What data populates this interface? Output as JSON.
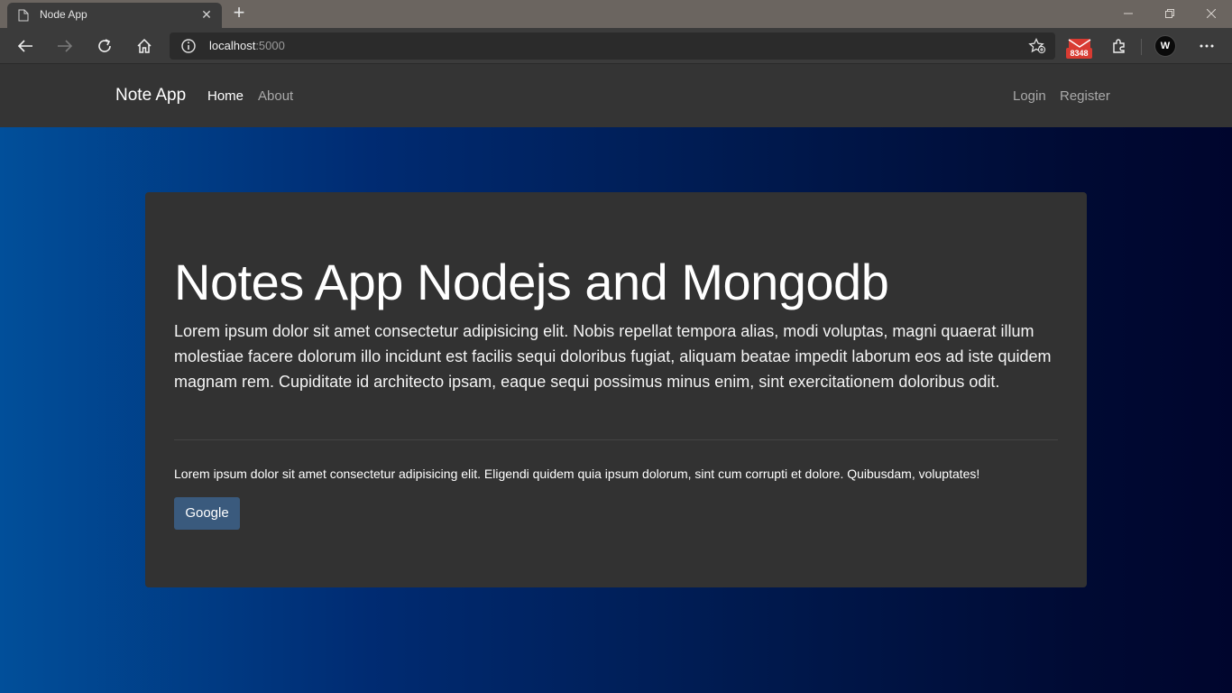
{
  "browser": {
    "tab": {
      "title": "Node App",
      "close_glyph": "✕",
      "icon": "page-icon"
    },
    "newtab_glyph": "+",
    "address": {
      "host": "localhost",
      "port": ":5000"
    },
    "mail_badge": "8348",
    "profile_initial": "W"
  },
  "nav": {
    "brand": "Note App",
    "links": [
      "Home",
      "About"
    ],
    "right_links": [
      "Login",
      "Register"
    ]
  },
  "jumbotron": {
    "title": "Notes App Nodejs and Mongodb",
    "lead": "Lorem ipsum dolor sit amet consectetur adipisicing elit. Nobis repellat tempora alias, modi voluptas, magni quaerat illum molestiae facere dolorum illo incidunt est facilis sequi doloribus fugiat, aliquam beatae impedit laborum eos ad iste quidem magnam rem. Cupiditate id architecto ipsam, eaque sequi possimus minus enim, sint exercitationem doloribus odit.",
    "text": "Lorem ipsum dolor sit amet consectetur adipisicing elit. Eligendi quidem quia ipsum dolorum, sint cum corrupti et dolore. Quibusdam, voluptates!",
    "button_label": "Google"
  },
  "colors": {
    "navbar": "#343434",
    "card": "#323232",
    "button": "#3a5a7d",
    "gradient_left": "#014f9a",
    "gradient_right": "#00052d"
  }
}
